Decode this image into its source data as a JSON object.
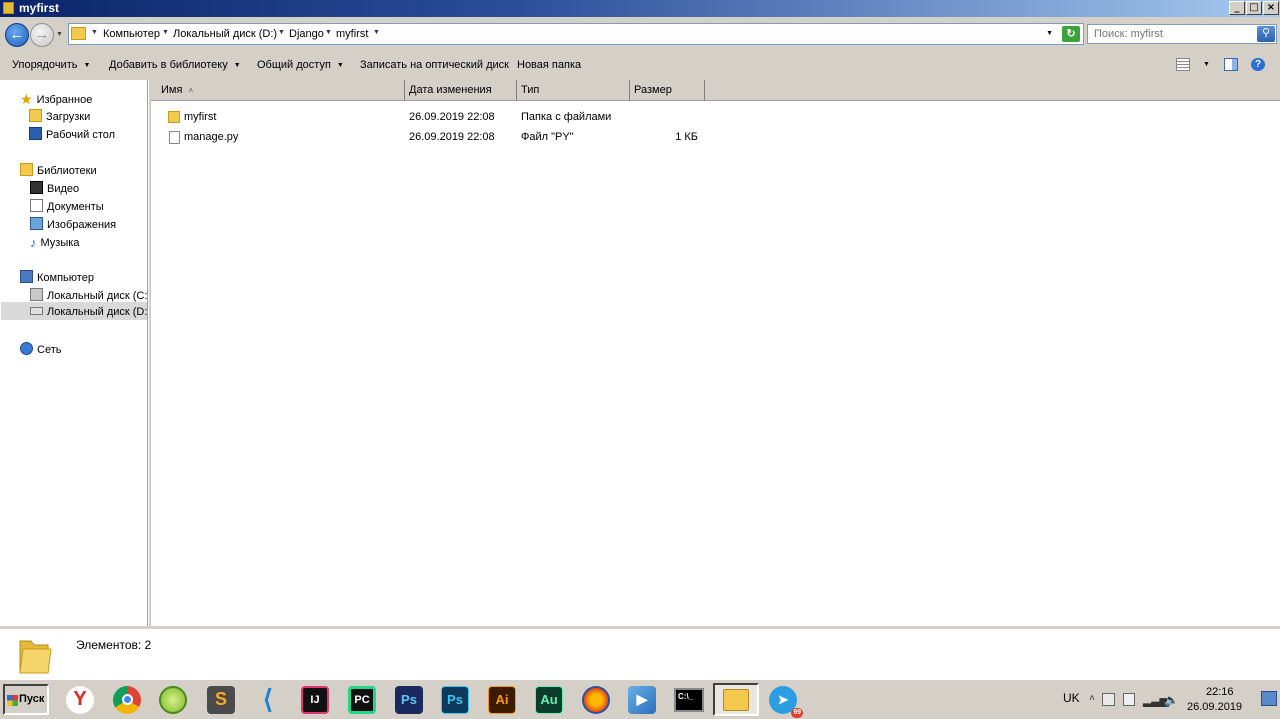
{
  "window": {
    "title": "myfirst",
    "controls": [
      "_",
      "0",
      "X"
    ]
  },
  "address": {
    "breadcrumbs": [
      "Компьютер",
      "Локальный диск (D:)",
      "Django",
      "myfirst"
    ],
    "search_placeholder": "Поиск: myfirst"
  },
  "toolbar": {
    "organize": "Упорядочить",
    "add_to_library": "Добавить в библиотеку",
    "share": "Общий доступ",
    "burn": "Записать на оптический диск",
    "new_folder": "Новая папка"
  },
  "sidebar": {
    "favorites": {
      "label": "Избранное",
      "items": [
        "Загрузки",
        "Рабочий стол"
      ]
    },
    "libraries": {
      "label": "Библиотеки",
      "items": [
        "Видео",
        "Документы",
        "Изображения",
        "Музыка"
      ]
    },
    "computer": {
      "label": "Компьютер",
      "items": [
        "Локальный диск (C:)",
        "Локальный диск (D:)"
      ],
      "selected": "Локальный диск (D:)"
    },
    "network": {
      "label": "Сеть"
    }
  },
  "columns": [
    "Имя",
    "Дата изменения",
    "Тип",
    "Размер"
  ],
  "files": [
    {
      "name": "myfirst",
      "date": "26.09.2019 22:08",
      "type": "Папка с файлами",
      "size": "",
      "icon": "folder-icon"
    },
    {
      "name": "manage.py",
      "date": "26.09.2019 22:08",
      "type": "Файл \"PY\"",
      "size": "1 КБ",
      "icon": "file-icon"
    }
  ],
  "details": {
    "count_label": "Элементов: 2"
  },
  "taskbar": {
    "start": "Пуск",
    "apps": [
      {
        "name": "yandex-browser",
        "glyph": "Y",
        "bg": "#ffffff",
        "fg": "#e52620"
      },
      {
        "name": "chrome",
        "glyph": "",
        "bg": "#ffffff",
        "fg": "#ffffff"
      },
      {
        "name": "lime-app",
        "glyph": "",
        "bg": "#ffffff",
        "fg": "#ffffff"
      },
      {
        "name": "sublime-text",
        "glyph": "S",
        "bg": "#4a4a4a",
        "fg": "#f9a825"
      },
      {
        "name": "vscode",
        "glyph": "",
        "bg": "#ffffff",
        "fg": "#1f7fd6"
      },
      {
        "name": "intellij-idea",
        "glyph": "IJ",
        "bg": "#111111",
        "fg": "#ffffff"
      },
      {
        "name": "pycharm",
        "glyph": "PC",
        "bg": "#21d789",
        "fg": "#000000"
      },
      {
        "name": "photoshop-1",
        "glyph": "Ps",
        "bg": "#1a2a5e",
        "fg": "#5ec4f5"
      },
      {
        "name": "photoshop-2",
        "glyph": "Ps",
        "bg": "#0d3a5a",
        "fg": "#38c8f5"
      },
      {
        "name": "illustrator",
        "glyph": "Ai",
        "bg": "#3b1a00",
        "fg": "#ff9a00"
      },
      {
        "name": "audition",
        "glyph": "Au",
        "bg": "#0c3d2c",
        "fg": "#62f0b2"
      },
      {
        "name": "audacity",
        "glyph": "",
        "bg": "#ffffff",
        "fg": "#ffffff"
      },
      {
        "name": "media-player",
        "glyph": "",
        "bg": "#ffffff",
        "fg": "#ffffff"
      },
      {
        "name": "cmd",
        "glyph": "C:\\_",
        "bg": "#000000",
        "fg": "#ffffff"
      },
      {
        "name": "explorer",
        "glyph": "",
        "bg": "#f2c94c",
        "fg": "#ffffff"
      },
      {
        "name": "telegram",
        "glyph": "",
        "bg": "#2a9ee0",
        "fg": "#ffffff"
      }
    ],
    "active": "explorer",
    "telegram_badge": "99",
    "tray": {
      "lang": "UK",
      "time": "22:16",
      "date": "26.09.2019"
    }
  }
}
